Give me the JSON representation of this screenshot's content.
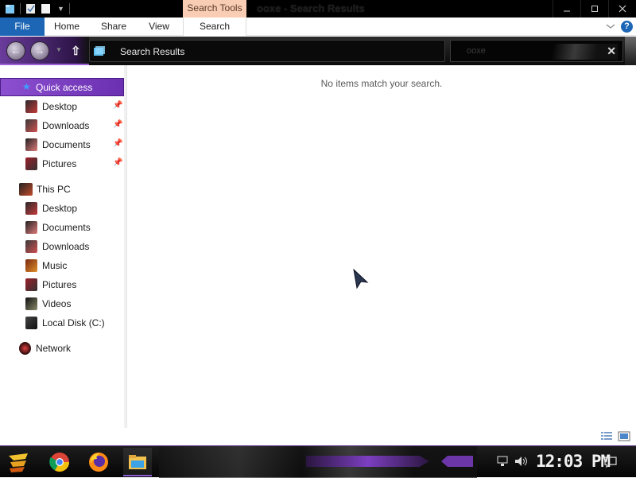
{
  "window": {
    "title": "ooxe - Search Results",
    "context_tab_group": "Search Tools"
  },
  "ribbon": {
    "tabs": [
      "File",
      "Home",
      "Share",
      "View",
      "Search"
    ]
  },
  "address_bar": {
    "path": "Search Results",
    "search_value": "ooxe"
  },
  "nav": {
    "quick_access": {
      "label": "Quick access",
      "items": [
        {
          "label": "Desktop",
          "icon": "desktop-icon",
          "pinned": true
        },
        {
          "label": "Downloads",
          "icon": "downloads-icon",
          "pinned": true
        },
        {
          "label": "Documents",
          "icon": "documents-icon",
          "pinned": true
        },
        {
          "label": "Pictures",
          "icon": "pictures-icon",
          "pinned": true
        }
      ]
    },
    "this_pc": {
      "label": "This PC",
      "items": [
        {
          "label": "Desktop",
          "icon": "desktop-icon"
        },
        {
          "label": "Documents",
          "icon": "documents-icon"
        },
        {
          "label": "Downloads",
          "icon": "downloads-icon"
        },
        {
          "label": "Music",
          "icon": "music-icon"
        },
        {
          "label": "Pictures",
          "icon": "pictures-icon"
        },
        {
          "label": "Videos",
          "icon": "videos-icon"
        },
        {
          "label": "Local Disk (C:)",
          "icon": "drive-icon"
        }
      ]
    },
    "network": {
      "label": "Network"
    }
  },
  "content": {
    "empty_message": "No items match your search."
  },
  "taskbar": {
    "apps": [
      "start",
      "chrome",
      "firefox",
      "file-explorer"
    ],
    "clock": "12:03 PM"
  },
  "colors": {
    "accent": "#1c66b5",
    "selection": "#7a3fc4",
    "context_tab": "#f8cdb3"
  }
}
